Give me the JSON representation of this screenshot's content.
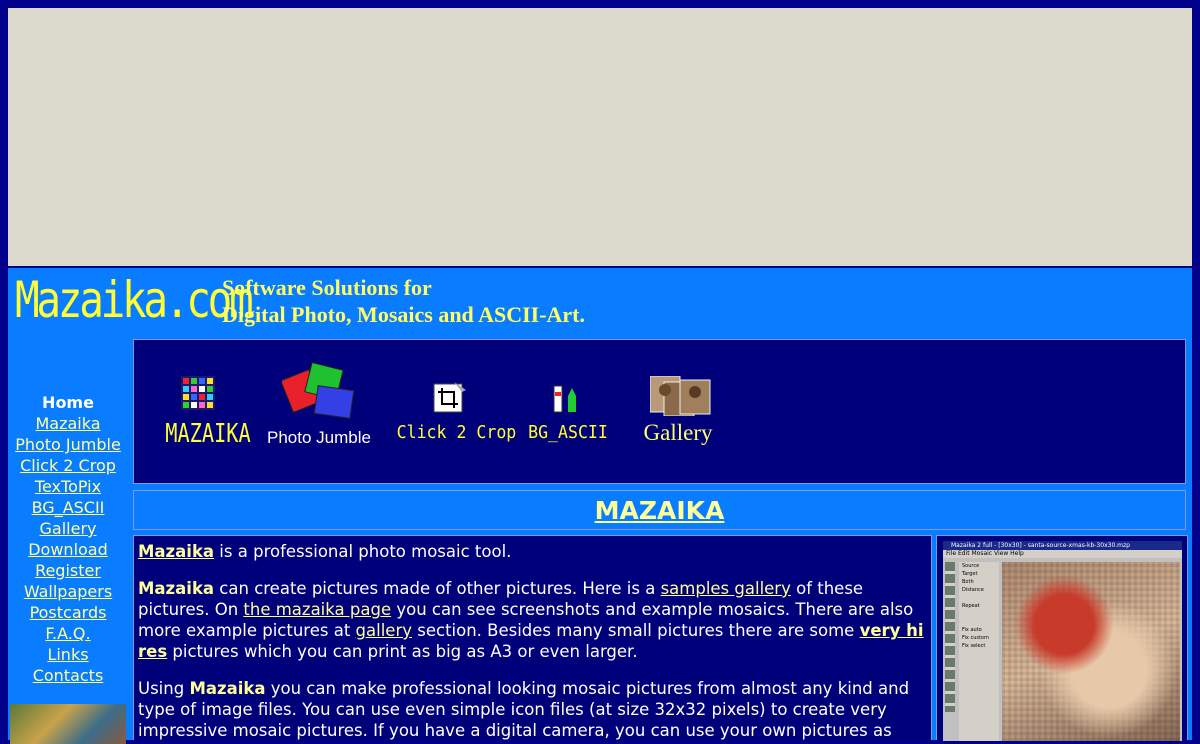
{
  "banner": {
    "logo": "Mazaika.com",
    "tagline_line1": "Software Solutions for",
    "tagline_line2": "Digital Photo, Mosaics and ASCII-Art."
  },
  "nav": {
    "items": [
      {
        "label": "Home",
        "current": true
      },
      {
        "label": "Mazaika"
      },
      {
        "label": "Photo Jumble"
      },
      {
        "label": "Click 2 Crop"
      },
      {
        "label": "TexToPix"
      },
      {
        "label": "BG_ASCII"
      },
      {
        "label": "Gallery"
      },
      {
        "label": "Download"
      },
      {
        "label": "Register"
      },
      {
        "label": "Wallpapers"
      },
      {
        "label": "Postcards"
      },
      {
        "label": "F.A.Q."
      },
      {
        "label": "Links"
      },
      {
        "label": "Contacts"
      }
    ]
  },
  "products": {
    "mazaika": "MAZAIKA",
    "photo_jumble": "Photo Jumble",
    "click2crop": "Click 2 Crop",
    "bg_ascii": "BG_ASCII",
    "gallery": "Gallery"
  },
  "section": {
    "title": "MAZAIKA"
  },
  "content": {
    "p1": {
      "link": "Mazaika",
      "text": " is a professional photo mosaic tool."
    },
    "p2": {
      "bold": "Mazaika",
      "t1": " can create pictures made of other pictures. Here is a ",
      "link1": "samples gallery",
      "t2": " of these pictures. On ",
      "link2": "the mazaika page",
      "t3": " you can see screenshots and example mosaics. There are also more example pictures at ",
      "link3": "gallery",
      "t4": " section. Besides many small pictures there are some ",
      "link4": "very hi res",
      "t5": " pictures which you can print as big as A3 or even larger."
    },
    "p3": {
      "t1": "Using ",
      "bold": "Mazaika",
      "t2": " you can make professional looking mosaic pictures from almost any kind and type of image files. You can use even simple icon files (at size 32x32 pixels) to create very impressive mosaic pictures. If you have a digital camera, you can use your own pictures as tiles. Note that even in trial"
    }
  },
  "screenshot": {
    "title": "Mazaika 2 full - [30x30] - santa-source-xmas-kb-30x30.mzp",
    "menu": "File  Edit  Mosaic  View  Help",
    "form_labels": [
      "Source",
      "Target",
      "Both",
      "Distance",
      "Repeat",
      "Fix auto",
      "Fix custom",
      "Fix select"
    ]
  },
  "colors": {
    "page_bg": "#00008b",
    "banner_bg": "#0a7cff",
    "accent_yellow": "#ffff33",
    "link_yellow": "#ffff99",
    "ad_bg": "#dcd9cd"
  }
}
